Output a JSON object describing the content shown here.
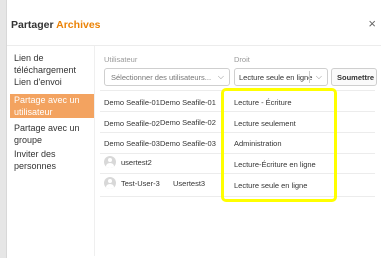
{
  "dialog": {
    "title_prefix": "Partager",
    "title_name": "Archives",
    "close_glyph": "×",
    "accent_color": "#eb8205"
  },
  "nav": [
    {
      "label_lines": [
        "Lien de",
        "téléchargement"
      ],
      "active": false
    },
    {
      "label_lines": [
        "Lien d'envoi"
      ],
      "active": false
    },
    {
      "label_lines": [
        "Partage avec un",
        "utilisateur"
      ],
      "active": true
    },
    {
      "label_lines": [
        "Partage avec un",
        "groupe"
      ],
      "active": false
    },
    {
      "label_lines": [
        "Inviter des",
        "personnes"
      ],
      "active": false
    }
  ],
  "table": {
    "col_user": "Utilisateur",
    "col_right": "Droit",
    "user_select_placeholder": "Sélectionner des utilisateurs...",
    "right_select_value": "Lecture seule en ligne",
    "submit_label": "Soumettre",
    "rows": [
      {
        "user": "Demo Seafile-01",
        "name": "Demo Seafile-01",
        "right": "Lecture - Écriture",
        "avatar": false
      },
      {
        "user": "Demo Seafile-02",
        "name": "Demo Seafile-02",
        "right": "Lecture seulement",
        "avatar": false
      },
      {
        "user": "Demo Seafile-03",
        "name": "Demo Seafile-03",
        "right": "Administration",
        "avatar": false
      },
      {
        "user": "usertest2",
        "name": "",
        "right": "Lecture-Écriture en ligne",
        "avatar": true
      },
      {
        "user": "Test-User-3",
        "name": "Usertest3",
        "right": "Lecture seule en ligne",
        "avatar": true
      }
    ]
  },
  "annotation": {
    "highlight_color": "#ffff00"
  }
}
